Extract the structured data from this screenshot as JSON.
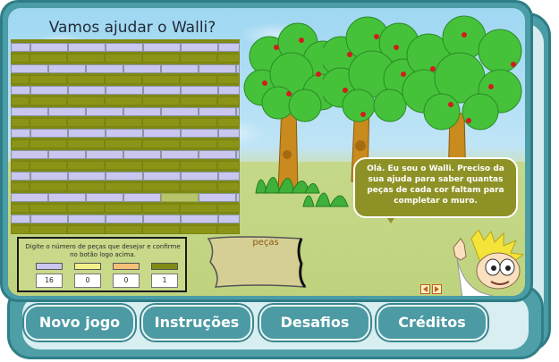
{
  "title": "Vamos ajudar o Walli?",
  "instructions": "Digite o número de peças que desejar e confirme no botão logo acima.",
  "counters": [
    {
      "color": "#c9c6ef",
      "value": "16"
    },
    {
      "color": "#f3f08a",
      "value": "0"
    },
    {
      "color": "#f4c07a",
      "value": "0"
    },
    {
      "color": "#7f8a15",
      "value": "1"
    }
  ],
  "scroll_label": "peças",
  "speech": "Olá. Eu sou o Walli. Preciso da sua ajuda para saber quantas peças de cada cor faltam para completar o muro.",
  "nav": {
    "new_game": "Novo jogo",
    "instructions": "Instruções",
    "challenges": "Desafios",
    "credits": "Créditos"
  },
  "colors": {
    "frame": "#4a9ca6",
    "wall_olive": "#7f8a15",
    "brick_lavender": "#c9c6ef",
    "bubble": "#8e9226"
  }
}
